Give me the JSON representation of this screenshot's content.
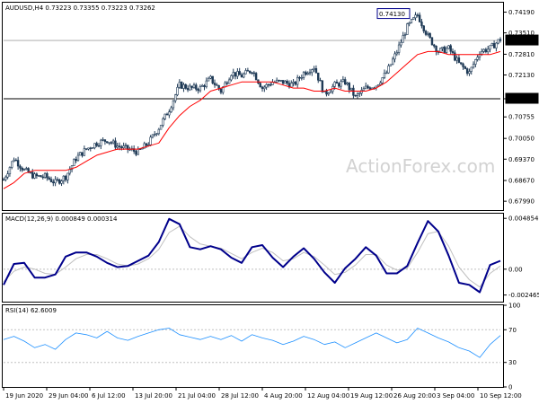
{
  "symbol_info": "AUDUSD,H4  0.73223 0.73355 0.73223 0.73262",
  "watermark": "ActionForex.com",
  "colors": {
    "candle": "#1f3a56",
    "ma": "#ff0000",
    "macd": "#00008b",
    "signal": "#c0c0c0",
    "rsi": "#1e90ff",
    "hline": "#000000",
    "marker": "#00008b",
    "current": "#000000"
  },
  "chart_data": [
    {
      "type": "line",
      "title": "AUDUSD,H4  0.73223 0.73355 0.73223 0.73262",
      "ylim": [
        0.677,
        0.745
      ],
      "y_ticks": [
        "0.74190",
        "0.73510",
        "0.72810",
        "0.72130",
        "0.71350",
        "0.70755",
        "0.70050",
        "0.69370",
        "0.68670",
        "0.67990"
      ],
      "y_tick_values": [
        0.7419,
        0.7351,
        0.7281,
        0.7213,
        0.7135,
        0.70755,
        0.7005,
        0.6937,
        0.6867,
        0.6799
      ],
      "price_labels": {
        "high": "0.74130",
        "current": "0.73262",
        "level": "0.71350"
      },
      "levels": {
        "high": 0.7413,
        "current": 0.73262,
        "support": 0.7135
      },
      "series": [
        {
          "values": [
            0.687,
            0.694,
            0.69,
            0.688,
            0.688,
            0.686,
            0.688,
            0.694,
            0.697,
            0.699,
            0.7,
            0.698,
            0.697,
            0.696,
            0.699,
            0.704,
            0.71,
            0.718,
            0.717,
            0.717,
            0.72,
            0.716,
            0.722,
            0.721,
            0.723,
            0.717,
            0.719,
            0.719,
            0.718,
            0.722,
            0.724,
            0.715,
            0.718,
            0.719,
            0.714,
            0.717,
            0.718,
            0.722,
            0.729,
            0.737,
            0.741,
            0.734,
            0.729,
            0.73,
            0.725,
            0.722,
            0.729,
            0.73,
            0.733
          ]
        },
        {
          "values": [
            0.684,
            0.686,
            0.689,
            0.69,
            0.69,
            0.69,
            0.69,
            0.691,
            0.693,
            0.695,
            0.696,
            0.697,
            0.697,
            0.697,
            0.698,
            0.699,
            0.704,
            0.708,
            0.711,
            0.713,
            0.716,
            0.717,
            0.718,
            0.719,
            0.719,
            0.719,
            0.719,
            0.718,
            0.717,
            0.717,
            0.716,
            0.716,
            0.717,
            0.716,
            0.716,
            0.716,
            0.717,
            0.719,
            0.722,
            0.725,
            0.728,
            0.729,
            0.729,
            0.728,
            0.728,
            0.728,
            0.728,
            0.728,
            0.729
          ]
        }
      ]
    },
    {
      "type": "line",
      "title": "MACD(12,26,9) 0.000849 0.000314",
      "ylim": [
        -0.0031,
        0.0053
      ],
      "y_ticks": [
        "0.004854",
        "0.00",
        "-0.002465"
      ],
      "y_tick_values": [
        0.004854,
        0.0,
        -0.002465
      ],
      "series": [
        {
          "values": [
            -0.0015,
            0.0005,
            0.0006,
            -0.0008,
            -0.0008,
            -0.0005,
            0.0012,
            0.0016,
            0.0016,
            0.0012,
            0.0006,
            0.0002,
            0.0003,
            0.0008,
            0.0013,
            0.0026,
            0.0048,
            0.0043,
            0.0021,
            0.0019,
            0.0022,
            0.0019,
            0.0011,
            0.0006,
            0.0021,
            0.0023,
            0.0011,
            0.0002,
            0.0012,
            0.002,
            0.001,
            -0.0003,
            -0.0013,
            0.0001,
            0.001,
            0.0021,
            0.0013,
            -0.0004,
            -0.0004,
            0.0003,
            0.0025,
            0.0046,
            0.0036,
            0.0013,
            -0.0013,
            -0.0015,
            -0.0022,
            0.0004,
            0.0008
          ]
        },
        {
          "values": [
            -0.0012,
            -0.0002,
            0.0002,
            0.0,
            -0.0004,
            -0.0005,
            0.0002,
            0.001,
            0.0014,
            0.0014,
            0.001,
            0.0005,
            0.0003,
            0.0005,
            0.001,
            0.0019,
            0.0035,
            0.0041,
            0.0031,
            0.0024,
            0.0022,
            0.002,
            0.0015,
            0.001,
            0.0016,
            0.002,
            0.0016,
            0.0008,
            0.001,
            0.0016,
            0.0012,
            0.0004,
            -0.0005,
            -0.0003,
            0.0004,
            0.0014,
            0.0014,
            0.0004,
            -0.0001,
            0.0001,
            0.0016,
            0.0034,
            0.0036,
            0.0022,
            0.0002,
            -0.001,
            -0.0017,
            -0.0004,
            0.0003
          ]
        }
      ]
    },
    {
      "type": "line",
      "title": "RSI(14) 62.6009",
      "ylim": [
        0,
        100
      ],
      "y_ticks": [
        "100",
        "70",
        "30",
        "0"
      ],
      "y_tick_values": [
        100,
        70,
        30,
        0
      ],
      "series": [
        {
          "values": [
            58,
            62,
            56,
            48,
            52,
            46,
            58,
            66,
            64,
            60,
            68,
            60,
            57,
            62,
            66,
            70,
            72,
            64,
            61,
            58,
            62,
            58,
            63,
            56,
            64,
            60,
            57,
            52,
            56,
            62,
            58,
            52,
            55,
            48,
            54,
            60,
            66,
            60,
            54,
            58,
            72,
            66,
            60,
            55,
            48,
            44,
            36,
            52,
            63
          ]
        }
      ]
    }
  ],
  "x_labels": [
    "19 Jun 2020",
    "29 Jun 04:00",
    "6 Jul 12:00",
    "13 Jul 20:00",
    "21 Jul 04:00",
    "28 Jul 12:00",
    "4 Aug 20:00",
    "12 Aug 04:00",
    "19 Aug 12:00",
    "26 Aug 20:00",
    "3 Sep 04:00",
    "10 Sep 12:00"
  ]
}
